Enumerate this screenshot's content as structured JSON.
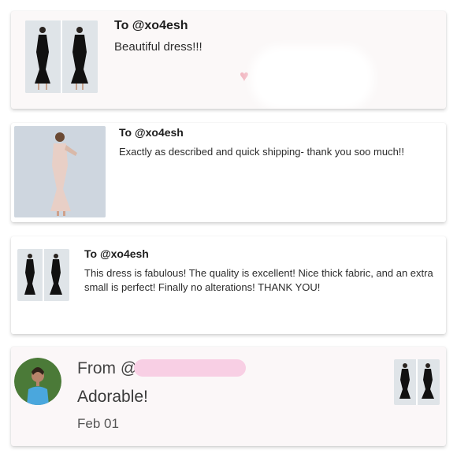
{
  "reviews": [
    {
      "to": "To @xo4esh",
      "message": "Beautiful dress!!!",
      "heart": "♥"
    },
    {
      "to": "To @xo4esh",
      "message": "Exactly as described and quick shipping- thank you soo much!!"
    },
    {
      "to": "To @xo4esh",
      "message": "This dress is fabulous! The quality is excellent! Nice thick fabric, and an extra small is perfect! Finally no alterations! THANK YOU!"
    }
  ],
  "from_card": {
    "from_prefix": "From @",
    "message": "Adorable!",
    "date": "Feb 01"
  },
  "colors": {
    "card_bg_top": "#fbf7f8",
    "heart": "#f2b8c2",
    "redact_pink": "#f8cfe4",
    "dress_black": "#15181c",
    "dress_nude": "#e8cfc6",
    "photo_bg": "#d8dfe6",
    "avatar_green": "#4b7a38",
    "avatar_top": "#4aa7dd"
  }
}
